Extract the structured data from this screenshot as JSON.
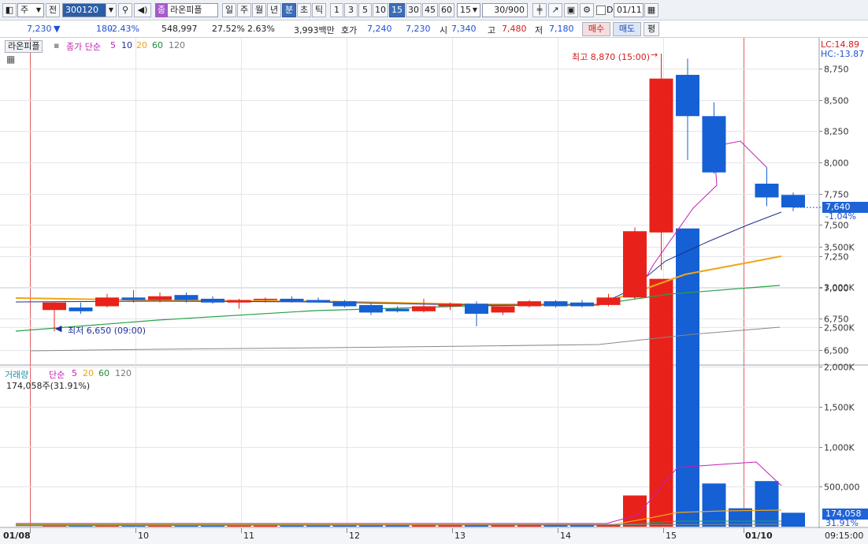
{
  "toolbar": {
    "market_select": "주",
    "prev_label": "전",
    "code": "300120",
    "stock_name": "라온피플",
    "stock_chip": "종",
    "period_buttons": [
      "일",
      "주",
      "월",
      "년",
      "분",
      "초",
      "틱"
    ],
    "active_period": "분",
    "interval_buttons": [
      "1",
      "3",
      "5",
      "10",
      "15",
      "30",
      "45",
      "60"
    ],
    "active_interval": "15",
    "interval_value": "15",
    "count_value": "30/900",
    "checkbox_label": "D",
    "date_value": "01/11"
  },
  "quote": {
    "price": "7,230",
    "arrow": "▼",
    "change": "180",
    "change_pct": "-2.43%",
    "volume": "548,997",
    "turnover_pct": "27.52%",
    "other_pct": "2.63%",
    "amount": "3,993백만",
    "hoga_label": "호가",
    "ask": "7,240",
    "bid": "7,230",
    "open_label": "시",
    "open": "7,340",
    "high_label": "고",
    "high": "7,480",
    "low_label": "저",
    "low": "7,180",
    "buy_button": "매수",
    "sell_button": "매도",
    "eval_button": "평"
  },
  "price_panel": {
    "legend_name": "라온피플",
    "legend_ma": "종가 단순",
    "ma_periods": [
      "5",
      "10",
      "20",
      "60",
      "120"
    ],
    "ma_colors": [
      "#c41fb8",
      "#1f2f9a",
      "#e8a317",
      "#1e8a3c",
      "#777777"
    ],
    "lc": "LC:14.89",
    "hc": "HC:-13.87",
    "max_annotation": "최고 8,870 (15:00)",
    "min_annotation": "최저 6,650 (09:00)",
    "current_price": "7,640",
    "current_pct": "-1.04%"
  },
  "volume_panel": {
    "legend_name": "거래량",
    "legend_ma": "단순",
    "ma_periods": [
      "5",
      "20",
      "60",
      "120"
    ],
    "summary": "174,058주(31.91%)",
    "current_volume": "174,058",
    "current_pct": "31.91%"
  },
  "x_axis": {
    "labels": [
      "01/08",
      "10",
      "11",
      "12",
      "13",
      "14",
      "15",
      "01/10"
    ],
    "time_label": "09:15:00"
  },
  "chart_data": {
    "type": "candlestick",
    "price_ticks": [
      6500,
      6750,
      7000,
      7250,
      7500,
      7750,
      8000,
      8250,
      8500,
      8750
    ],
    "price_tick_labels": [
      "6,500",
      "6,750",
      "7,000",
      "7,250",
      "7,500",
      "7,750",
      "8,000",
      "8,250",
      "8,500",
      "8,750"
    ],
    "volume_ticks": [
      500,
      1000,
      1500,
      2000,
      2500,
      3000,
      3500
    ],
    "volume_tick_labels": [
      "500,000",
      "1,000K",
      "1,500K",
      "2,000K",
      "2,500K",
      "3,000K",
      "3,500K"
    ],
    "candles": [
      {
        "o": 6820,
        "h": 6890,
        "l": 6650,
        "c": 6880
      },
      {
        "o": 6840,
        "h": 6880,
        "l": 6790,
        "c": 6810
      },
      {
        "o": 6850,
        "h": 6950,
        "l": 6840,
        "c": 6920
      },
      {
        "o": 6920,
        "h": 6980,
        "l": 6880,
        "c": 6900
      },
      {
        "o": 6900,
        "h": 6960,
        "l": 6880,
        "c": 6930
      },
      {
        "o": 6940,
        "h": 6960,
        "l": 6880,
        "c": 6900
      },
      {
        "o": 6910,
        "h": 6930,
        "l": 6870,
        "c": 6880
      },
      {
        "o": 6880,
        "h": 6910,
        "l": 6830,
        "c": 6900
      },
      {
        "o": 6900,
        "h": 6920,
        "l": 6880,
        "c": 6910
      },
      {
        "o": 6910,
        "h": 6930,
        "l": 6880,
        "c": 6890
      },
      {
        "o": 6900,
        "h": 6920,
        "l": 6880,
        "c": 6880
      },
      {
        "o": 6890,
        "h": 6900,
        "l": 6840,
        "c": 6850
      },
      {
        "o": 6860,
        "h": 6880,
        "l": 6780,
        "c": 6800
      },
      {
        "o": 6830,
        "h": 6850,
        "l": 6800,
        "c": 6810
      },
      {
        "o": 6810,
        "h": 6910,
        "l": 6800,
        "c": 6850
      },
      {
        "o": 6850,
        "h": 6880,
        "l": 6820,
        "c": 6870
      },
      {
        "o": 6870,
        "h": 6890,
        "l": 6690,
        "c": 6790
      },
      {
        "o": 6800,
        "h": 6850,
        "l": 6780,
        "c": 6850
      },
      {
        "o": 6850,
        "h": 6900,
        "l": 6840,
        "c": 6890
      },
      {
        "o": 6890,
        "h": 6900,
        "l": 6840,
        "c": 6850
      },
      {
        "o": 6880,
        "h": 6900,
        "l": 6840,
        "c": 6850
      },
      {
        "o": 6860,
        "h": 6950,
        "l": 6850,
        "c": 6920
      },
      {
        "o": 6920,
        "h": 7480,
        "l": 6910,
        "c": 7450
      },
      {
        "o": 7440,
        "h": 8870,
        "l": 7140,
        "c": 8670
      },
      {
        "o": 8700,
        "h": 8830,
        "l": 8020,
        "c": 8370
      },
      {
        "o": 8370,
        "h": 8480,
        "l": 7910,
        "c": 7920
      },
      {
        "o": 7830,
        "h": 7960,
        "l": 7650,
        "c": 7720
      },
      {
        "o": 7740,
        "h": 7760,
        "l": 7610,
        "c": 7640
      }
    ],
    "candle_slots": [
      1,
      2,
      3,
      4,
      5,
      6,
      7,
      8,
      9,
      10,
      11,
      12,
      13,
      14,
      15,
      16,
      17,
      18,
      19,
      20,
      21,
      22,
      23,
      24,
      25,
      26,
      28,
      29
    ],
    "ma5": [
      {
        "s": 26,
        "v": 8130
      },
      {
        "s": 27,
        "v": 8170
      },
      {
        "s": 28,
        "v": 7960
      }
    ],
    "volume_k": [
      20,
      25,
      30,
      20,
      25,
      25,
      20,
      20,
      20,
      20,
      20,
      20,
      20,
      20,
      20,
      20,
      20,
      20,
      20,
      20,
      20,
      20,
      390,
      3100,
      3730,
      540,
      230,
      570,
      174
    ]
  }
}
